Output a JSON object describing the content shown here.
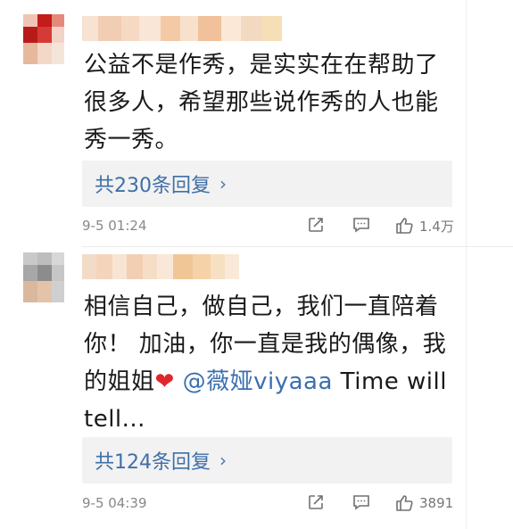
{
  "comments": [
    {
      "text": "公益不是作秀，是实实在在帮助了很多人，希望那些说作秀的人也能秀一秀。",
      "replies_label": "共230条回复",
      "replies_chevron": "›",
      "time": "9-5 01:24",
      "likes": "1.4万",
      "avatar_colors": [
        "#f0c4b4",
        "#c41b1b",
        "#e58a7a",
        "#b81a1a",
        "#d63a36",
        "#f3d2c8",
        "#e7b89e",
        "#f2d8c6",
        "#f5e5d8"
      ],
      "name_colors": [
        "#f8e2d2",
        "#f1cdb4",
        "#f6d9c3",
        "#f9e6d6",
        "#f3c9a6",
        "#f7e1cd",
        "#f0c19a",
        "#fbe8d7",
        "#f3d9bf",
        "#f6dfb6"
      ]
    },
    {
      "text_before": "相信自己，做自己，我们一直陪着你！ 加油，你一直是我的偶像，我的姐姐",
      "heart": "❤",
      "mention": "@薇娅viyaaa",
      "text_after": " Time will tell...",
      "replies_label": "共124条回复",
      "replies_chevron": "›",
      "time": "9-5 04:39",
      "likes": "3891",
      "avatar_colors": [
        "#c9c9c9",
        "#bdbdbd",
        "#d7d7d7",
        "#a7a7a7",
        "#8c8c8c",
        "#c6c6c6",
        "#d9b89e",
        "#e3c4aa",
        "#cfcfcf"
      ],
      "name_colors": [
        "#f3dcc7",
        "#f4d4bb",
        "#f8e4d2",
        "#f2cfb2",
        "#f6ddc6",
        "#f9e8d8",
        "#f0c697",
        "#f5d2a7",
        "#f7e0c2",
        "#f9e9d8"
      ]
    }
  ]
}
